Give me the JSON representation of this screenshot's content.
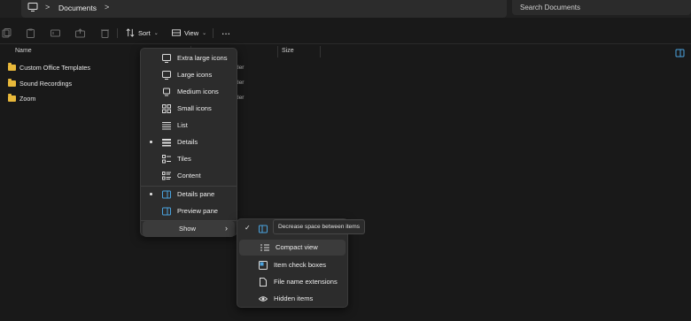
{
  "address": {
    "pc_icon": "monitor-icon",
    "separator": ">",
    "segment": "Documents",
    "trailing_separator": ">",
    "search_placeholder": "Search Documents"
  },
  "toolbar": {
    "sort_label": "Sort",
    "view_label": "View",
    "more_label": "..."
  },
  "columns": {
    "name": "Name",
    "size": "Size"
  },
  "files": [
    {
      "name": "Custom Office Templates",
      "type_fragment": "der"
    },
    {
      "name": "Sound Recordings",
      "type_fragment": "der"
    },
    {
      "name": "Zoom",
      "type_fragment": "der"
    }
  ],
  "view_menu": {
    "items": [
      {
        "label": "Extra large icons",
        "icon": "monitor-icon",
        "selected": false
      },
      {
        "label": "Large icons",
        "icon": "monitor-icon",
        "selected": false
      },
      {
        "label": "Medium icons",
        "icon": "monitor-small-icon",
        "selected": false
      },
      {
        "label": "Small icons",
        "icon": "grid-icon",
        "selected": false
      },
      {
        "label": "List",
        "icon": "list-icon",
        "selected": false
      },
      {
        "label": "Details",
        "icon": "details-icon",
        "selected": true
      },
      {
        "label": "Tiles",
        "icon": "tiles-icon",
        "selected": false
      },
      {
        "label": "Content",
        "icon": "content-icon",
        "selected": false
      },
      {
        "label": "Details pane",
        "icon": "details-pane-icon",
        "selected": true
      },
      {
        "label": "Preview pane",
        "icon": "preview-pane-icon",
        "selected": false
      },
      {
        "label": "Show",
        "icon": "",
        "selected": false
      }
    ]
  },
  "show_submenu": {
    "items": [
      {
        "label": "",
        "icon": "compact-icon",
        "checked": true
      },
      {
        "label": "Compact view",
        "icon": "compact-view-icon",
        "checked": false
      },
      {
        "label": "Item check boxes",
        "icon": "checkbox-icon",
        "checked": false
      },
      {
        "label": "File name extensions",
        "icon": "file-icon",
        "checked": false
      },
      {
        "label": "Hidden items",
        "icon": "eye-icon",
        "checked": false
      }
    ],
    "tooltip": "Decrease space between items"
  },
  "colors": {
    "background": "#191919",
    "menu": "#2c2c2c",
    "highlight": "#3b3b3b",
    "folder": "#e8b83a",
    "accent": "#4aa3df"
  }
}
